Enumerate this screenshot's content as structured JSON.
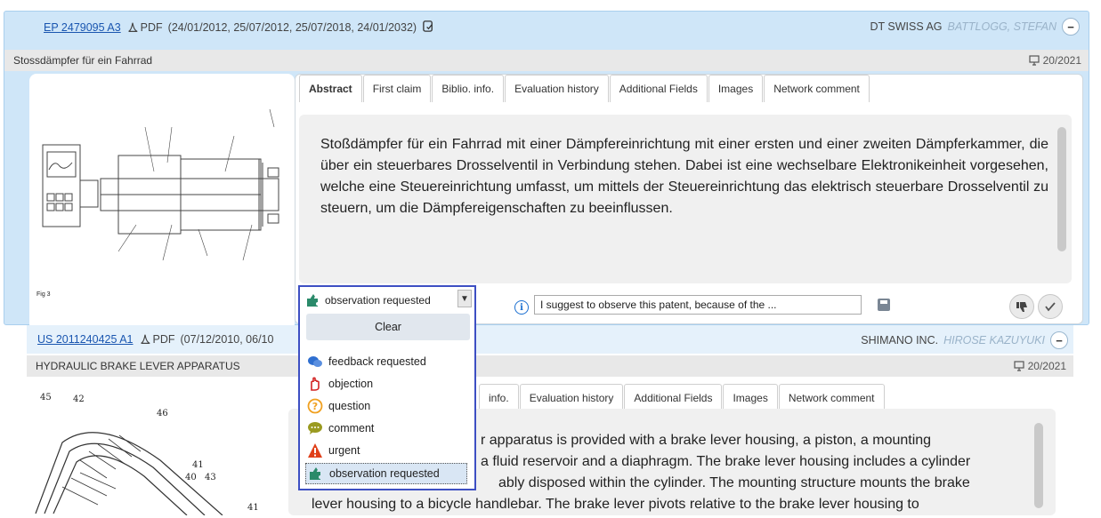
{
  "card1": {
    "pub_number": "EP 2479095 A3",
    "pdf_label": "PDF",
    "dates": "(24/01/2012, 25/07/2012, 25/07/2018, 24/01/2032)",
    "owner": "DT SWISS AG",
    "inventor": "BATTLOGG, STEFAN",
    "collapse_label": "−",
    "title": "Stossdämpfer für ein Fahrrad",
    "week": "20/2021",
    "figure_label": "Fig 3",
    "tabs": [
      "Abstract",
      "First claim",
      "Biblio. info.",
      "Evaluation history",
      "Additional Fields",
      "Images",
      "Network comment"
    ],
    "abstract": "Stoßdämpfer für ein Fahrrad mit einer Dämpfereinrichtung mit einer ersten und einer zweiten Dämpferkammer, die über ein steuerbares Drosselventil in Verbindung stehen. Dabei ist eine wechselbare Elektronikeinheit vorgesehen, welche eine Steuereinrichtung umfasst, um mittels der Steuereinrichtung das elektrisch steuerbare Drosselventil zu steuern, um die Dämpfereigenschaften zu beeinflussen.",
    "comment_value": "I suggest to observe this patent, because of the ..."
  },
  "card2": {
    "pub_number": "US 2011240425 A1",
    "pdf_label": "PDF",
    "dates_partial": "(07/12/2010, 06/10",
    "owner": "SHIMANO INC.",
    "inventor": "HIROSE KAZUYUKI",
    "collapse_label": "−",
    "title": "HYDRAULIC BRAKE LEVER APPARATUS",
    "week": "20/2021",
    "tabs_visible": [
      "info.",
      "Evaluation history",
      "Additional Fields",
      "Images",
      "Network comment"
    ],
    "abstract_lines": [
      "r apparatus is provided with a brake lever housing, a piston, a mounting",
      "a fluid reservoir and a diaphragm. The brake lever housing includes a cylinder",
      "ably disposed within the cylinder. The mounting structure mounts the brake",
      "lever housing to a bicycle handlebar. The brake lever pivots relative to the brake lever housing to"
    ],
    "fig_labels": [
      "45",
      "42",
      "46",
      "41",
      "40",
      "43",
      "41"
    ]
  },
  "dropdown": {
    "selected": "observation requested",
    "clear_label": "Clear",
    "options": [
      {
        "label": "feedback requested",
        "icon": "feedback-icon",
        "color": "#2f6fd0"
      },
      {
        "label": "objection",
        "icon": "hand-icon",
        "color": "#d22222"
      },
      {
        "label": "question",
        "icon": "question-icon",
        "color": "#f0a020"
      },
      {
        "label": "comment",
        "icon": "comment-icon",
        "color": "#9a9a20"
      },
      {
        "label": "urgent",
        "icon": "warning-icon",
        "color": "#e0401a"
      },
      {
        "label": "observation requested",
        "icon": "puzzle-icon",
        "color": "#2a8a6a"
      }
    ]
  }
}
